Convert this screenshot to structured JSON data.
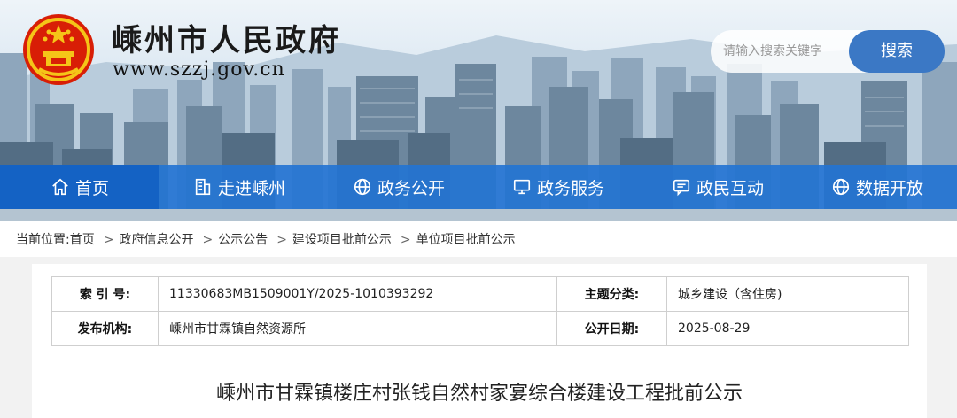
{
  "site": {
    "title": "嵊州市人民政府",
    "url": "www.szzj.gov.cn",
    "logo_icon": "national-emblem-icon"
  },
  "search": {
    "placeholder": "请输入搜索关键字",
    "button_label": "搜索"
  },
  "nav": {
    "items": [
      {
        "label": "首页",
        "icon": "home-icon",
        "active": true
      },
      {
        "label": "走进嵊州",
        "icon": "building-icon",
        "active": false
      },
      {
        "label": "政务公开",
        "icon": "globe-icon",
        "active": false
      },
      {
        "label": "政务服务",
        "icon": "monitor-icon",
        "active": false
      },
      {
        "label": "政民互动",
        "icon": "chat-icon",
        "active": false
      },
      {
        "label": "数据开放",
        "icon": "globe-icon",
        "active": false
      }
    ]
  },
  "breadcrumb": {
    "prefix": "当前位置:",
    "items": [
      "首页",
      "政府信息公开",
      "公示公告",
      "建设项目批前公示",
      "单位项目批前公示"
    ]
  },
  "meta": {
    "index_label": "索 引 号:",
    "index_value": "11330683MB1509001Y/2025-1010393292",
    "topic_label": "主题分类:",
    "topic_value": "城乡建设（含住房)",
    "publisher_label": "发布机构:",
    "publisher_value": "嵊州市甘霖镇自然资源所",
    "date_label": "公开日期:",
    "date_value": "2025-08-29"
  },
  "document": {
    "title": "嵊州市甘霖镇楼庄村张钱自然村家宴综合楼建设工程批前公示"
  },
  "colors": {
    "nav_bg": "#2474d2",
    "nav_active": "#1462c4",
    "search_button": "#3b78c5"
  }
}
